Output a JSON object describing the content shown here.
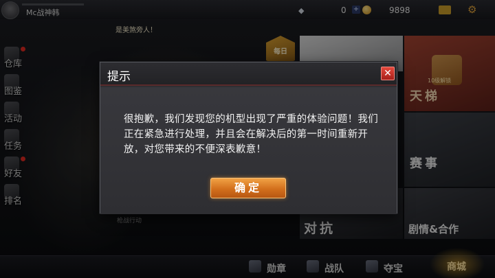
{
  "topbar": {
    "player_name": "Mc战神韩",
    "gem_count": "0",
    "coin_count": "9898",
    "plus_label": "+"
  },
  "broadcast": "是美煞旁人！",
  "left_menu": {
    "items": [
      {
        "label": "仓库",
        "badge": true
      },
      {
        "label": "图鉴",
        "badge": false
      },
      {
        "label": "活动",
        "badge": false
      },
      {
        "label": "任务",
        "badge": false
      },
      {
        "label": "好友",
        "badge": true
      },
      {
        "label": "排名",
        "badge": false
      }
    ]
  },
  "soldier": {
    "battle_label": "枪战行动"
  },
  "right_panel": {
    "rank_text": "每日",
    "ladder_badge": "10级解锁",
    "ladder_title": "天梯",
    "event_title": "赛事",
    "vs_title": "对抗",
    "story_title": "剧情&合作"
  },
  "bottombar": {
    "items": [
      {
        "label": "勋章"
      },
      {
        "label": "战队"
      },
      {
        "label": "夺宝"
      }
    ],
    "shop_label": "商城"
  },
  "dialog": {
    "title": "提示",
    "close_label": "✕",
    "message": "很抱歉，我们发现您的机型出现了严重的体验问题！我们正在紧急进行处理，并且会在解决后的第一时间重新开放，对您带来的不便深表歉意！",
    "confirm_label": "确定"
  },
  "colors": {
    "confirm_button": "#d26f1c",
    "close_button": "#c9302a",
    "dialog_bg": "#2f2f33"
  }
}
